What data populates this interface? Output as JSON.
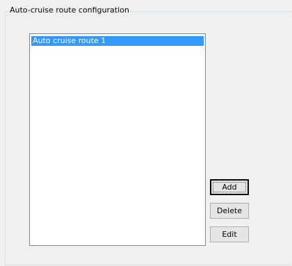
{
  "groupbox": {
    "title": "Auto-cruise route configuration"
  },
  "route_list": {
    "items": [
      {
        "label": "Auto cruise route 1",
        "selected": true
      }
    ]
  },
  "buttons": {
    "add_label": "Add",
    "delete_label": "Delete",
    "edit_label": "Edit"
  },
  "colors": {
    "selection": "#3399ff",
    "background": "#f0f0f0"
  }
}
